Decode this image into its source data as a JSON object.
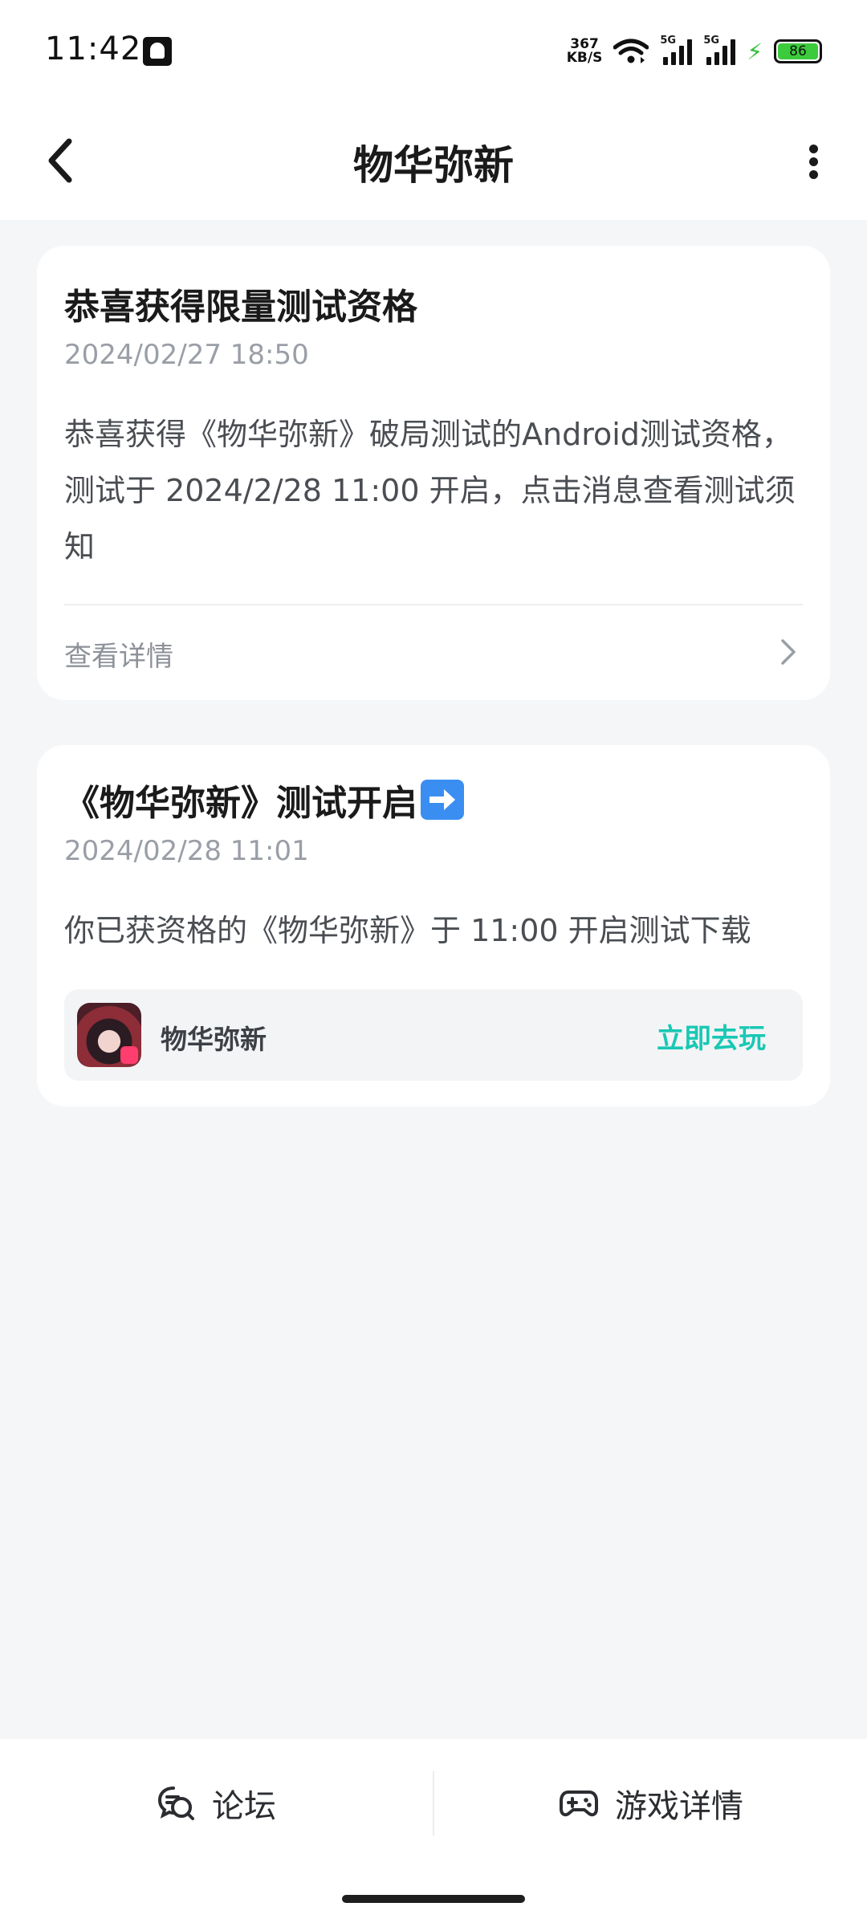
{
  "status_bar": {
    "time": "11:42",
    "net_speed_value": "367",
    "net_speed_unit": "KB/S",
    "signal1_label": "5G",
    "signal2_label": "5G",
    "battery_level": "86",
    "battery_color": "#3ccb3c"
  },
  "header": {
    "title": "物华弥新"
  },
  "messages": [
    {
      "title": "恭喜获得限量测试资格",
      "time": "2024/02/27 18:50",
      "body": "恭喜获得《物华弥新》破局测试的Android测试资格，测试于 2024/2/28 11:00 开启，点击消息查看测试须知",
      "link_label": "查看详情"
    },
    {
      "title": "《物华弥新》测试开启",
      "title_emoji": "right-arrow-emoji",
      "time": "2024/02/28 11:01",
      "body": "你已获资格的《物华弥新》于 11:00 开启测试下载",
      "game": {
        "name": "物华弥新",
        "action_label": "立即去玩",
        "action_color": "#19c8b4"
      }
    }
  ],
  "bottom_bar": {
    "forum_label": "论坛",
    "forum_icon": "forum-chat-icon",
    "game_detail_label": "游戏详情",
    "game_detail_icon": "gamepad-icon"
  }
}
